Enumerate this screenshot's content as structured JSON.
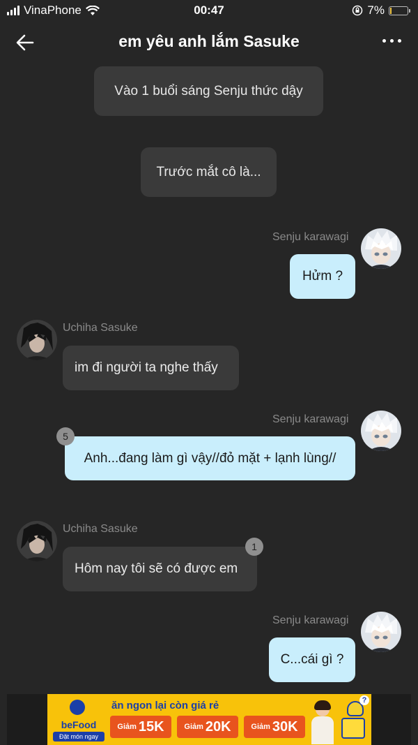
{
  "status": {
    "carrier": "VinaPhone",
    "time": "00:47",
    "battery": "7%"
  },
  "header": {
    "title": "em yêu anh lắm Sasuke"
  },
  "messages": {
    "narration1": "Vào 1 buổi sáng Senju thức dậy",
    "narration2": "Trước mắt cô là...",
    "m1": {
      "sender": "Senju karawagi",
      "text": "Hửm ?"
    },
    "m2": {
      "sender": "Uchiha Sasuke",
      "text": "im đi người ta nghe thấy"
    },
    "m3": {
      "sender": "Senju karawagi",
      "text": "Anh...đang làm gì vậy//đỏ mặt + lạnh lùng//",
      "badge": "5"
    },
    "m4": {
      "sender": "Uchiha Sasuke",
      "text": "Hôm nay tôi sẽ có được em",
      "badge": "1"
    },
    "m5": {
      "sender": "Senju karawagi",
      "text": "C...cái gì ?"
    }
  },
  "ad": {
    "brand": "beFood",
    "cta": "Đặt món ngay",
    "headline": "ăn ngon lại còn giá rẻ",
    "coupons": [
      {
        "label": "Giảm",
        "value": "15K"
      },
      {
        "label": "Giảm",
        "value": "20K"
      },
      {
        "label": "Giảm",
        "value": "30K"
      }
    ],
    "help": "?"
  },
  "colors": {
    "background": "#262626",
    "bubble_self": "#c9eefc",
    "bubble_other": "#3a3a3a",
    "ad_yellow": "#f8c20a",
    "ad_blue": "#1b3fa8"
  }
}
